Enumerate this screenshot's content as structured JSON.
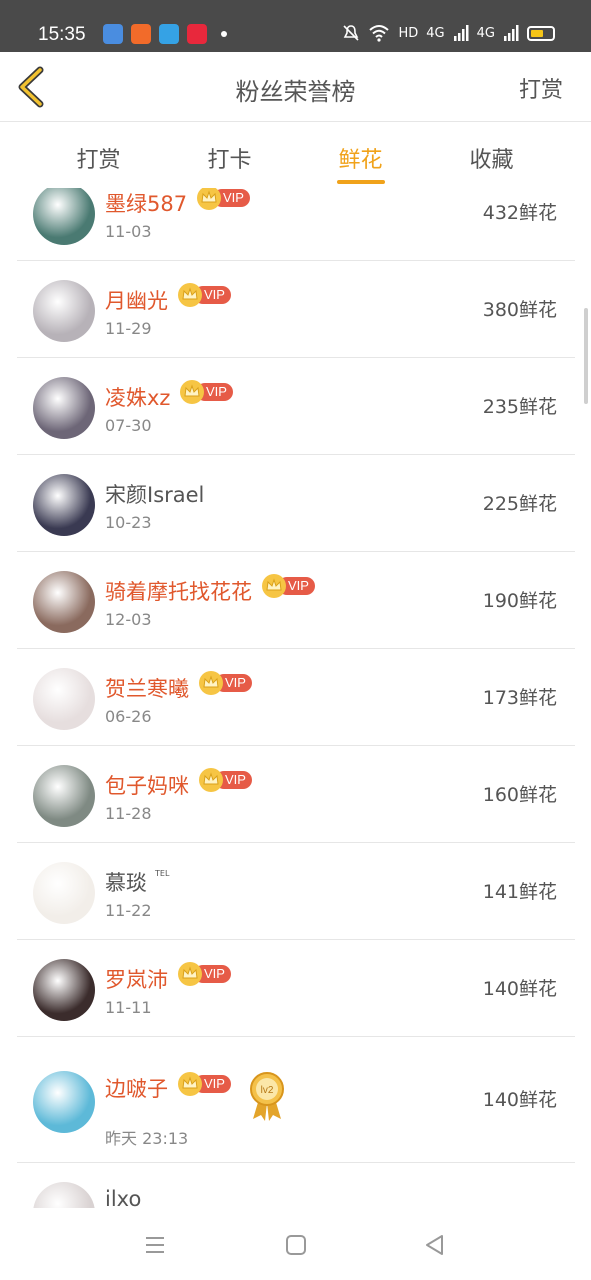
{
  "status": {
    "time": "15:35",
    "hd": "HD",
    "net1": "4G",
    "net2": "4G"
  },
  "header": {
    "title": "粉丝荣誉榜",
    "reward": "打赏"
  },
  "tabs": [
    {
      "label": "打赏"
    },
    {
      "label": "打卡"
    },
    {
      "label": "鲜花"
    },
    {
      "label": "收藏"
    }
  ],
  "active_tab": "鲜花",
  "vip_label": "VIP",
  "rows": [
    {
      "name": "墨绿587",
      "date": "11-03",
      "count": "432鲜花",
      "vip": true,
      "avatar_color": "#4a7a72"
    },
    {
      "name": "月幽光",
      "date": "11-29",
      "count": "380鲜花",
      "vip": true,
      "avatar_color": "#b7b2b8"
    },
    {
      "name": "凌姝xz",
      "date": "07-30",
      "count": "235鲜花",
      "vip": true,
      "avatar_color": "#6d6677"
    },
    {
      "name": "宋颜Israel",
      "date": "10-23",
      "count": "225鲜花",
      "vip": false,
      "avatar_color": "#3a3a52"
    },
    {
      "name": "骑着摩托找花花",
      "date": "12-03",
      "count": "190鲜花",
      "vip": true,
      "avatar_color": "#8a6a5e"
    },
    {
      "name": "贺兰寒曦",
      "date": "06-26",
      "count": "173鲜花",
      "vip": true,
      "avatar_color": "#e6dede"
    },
    {
      "name": "包子妈咪",
      "date": "11-28",
      "count": "160鲜花",
      "vip": true,
      "avatar_color": "#7f8a83"
    },
    {
      "name": "慕琰",
      "tel": "TEL",
      "date": "11-22",
      "count": "141鲜花",
      "vip": false,
      "avatar_color": "#f2eee9"
    },
    {
      "name": "罗岚沛",
      "date": "11-11",
      "count": "140鲜花",
      "vip": true,
      "avatar_color": "#3b2c2c"
    },
    {
      "name": "边啵子",
      "date": "昨天 23:13",
      "count": "140鲜花",
      "vip": true,
      "avatar_color": "#5db9d8"
    },
    {
      "name": "ilxo",
      "date": "",
      "count": "",
      "vip": false,
      "avatar_color": "#d9d2d2"
    }
  ],
  "medal": {
    "label": "lv2"
  },
  "colors": {
    "accent": "#f0a21a",
    "vip_name": "#e0582d",
    "vip_tag": "#e65b47",
    "crown": "#f6c544",
    "status_bar": "#4a4a4a"
  },
  "icons": [
    "back-chevron-icon",
    "crown-icon",
    "medal-icon",
    "menu-icon",
    "home-square-icon",
    "back-triangle-icon",
    "wifi-icon",
    "battery-icon",
    "mute-bell-icon"
  ]
}
